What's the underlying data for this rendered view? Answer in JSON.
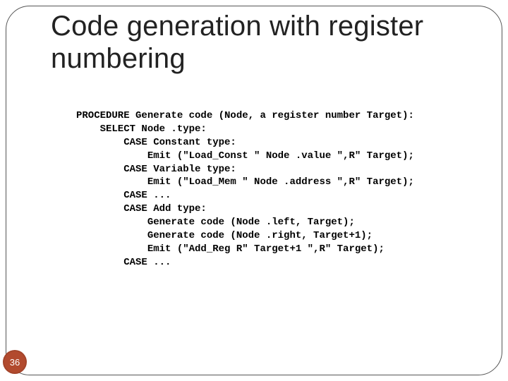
{
  "slide": {
    "title": "Code generation with register numbering",
    "page_number": "36"
  },
  "code": {
    "lines": [
      "PROCEDURE Generate code (Node, a register number Target):",
      "    SELECT Node .type:",
      "        CASE Constant type:",
      "            Emit (\"Load_Const \" Node .value \",R\" Target);",
      "        CASE Variable type:",
      "            Emit (\"Load_Mem \" Node .address \",R\" Target);",
      "        CASE ...",
      "        CASE Add type:",
      "            Generate code (Node .left, Target);",
      "            Generate code (Node .right, Target+1);",
      "            Emit (\"Add_Reg R\" Target+1 \",R\" Target);",
      "        CASE ..."
    ]
  }
}
